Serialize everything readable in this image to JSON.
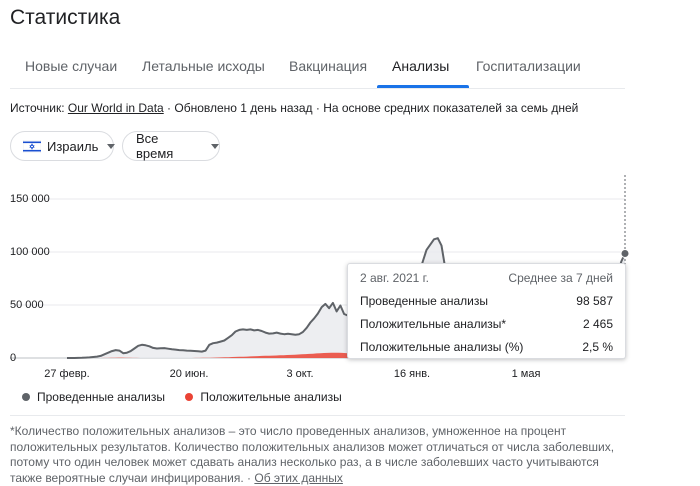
{
  "title": "Статистика",
  "tabs": [
    {
      "label": "Новые случаи",
      "active": false
    },
    {
      "label": "Летальные исходы",
      "active": false
    },
    {
      "label": "Вакцинация",
      "active": false
    },
    {
      "label": "Анализы",
      "active": true
    },
    {
      "label": "Госпитализации",
      "active": false
    }
  ],
  "source": {
    "prefix": "Источник: ",
    "link": "Our World in Data",
    "updated": " · Обновлено 1 день назад",
    "basis": " · На основе средних показателей за семь дней"
  },
  "filters": {
    "country": "Израиль",
    "period": "Все время"
  },
  "colors": {
    "tests": "#5f6368",
    "positive": "#ea4335",
    "accent": "#1a73e8"
  },
  "chart_data": {
    "type": "area",
    "x_tick_labels": [
      "27 февр.",
      "20 июн.",
      "3 окт.",
      "16 янв.",
      "1 мая"
    ],
    "y_tick_labels": [
      "150 000",
      "100 000",
      "50 000",
      "0"
    ],
    "ylim": [
      0,
      150000
    ],
    "grid": true,
    "series": [
      {
        "name": "Проведенные анализы",
        "color": "#5f6368",
        "values": [
          0,
          0,
          0,
          100,
          200,
          400,
          600,
          900,
          1300,
          2000,
          3500,
          5000,
          6500,
          7500,
          7000,
          4500,
          5000,
          6500,
          9000,
          11500,
          12500,
          12000,
          11000,
          9500,
          9000,
          9200,
          9300,
          8800,
          8200,
          7900,
          7500,
          7300,
          7000,
          6800,
          6600,
          6300,
          6000,
          7000,
          12500,
          14000,
          14500,
          15500,
          16500,
          19000,
          21500,
          25000,
          26500,
          27000,
          26500,
          27000,
          26000,
          26500,
          25500,
          24000,
          23000,
          23200,
          24000,
          23000,
          22500,
          22800,
          22500,
          22000,
          22500,
          24500,
          28500,
          33500,
          37500,
          42000,
          48000,
          51000,
          47000,
          52000,
          44000,
          49500,
          41500,
          40000,
          37500,
          35000,
          33500,
          32500,
          32000,
          32000,
          33500,
          32000,
          32000,
          35000,
          33500,
          35000,
          34500,
          38000,
          47500,
          51000,
          60000,
          68000,
          80000,
          91000,
          102000,
          107000,
          112000,
          113000,
          106000,
          85000,
          68000,
          57000,
          50000,
          44000,
          39000,
          35000,
          31000,
          27000,
          23000,
          19500,
          16000,
          13000,
          10500,
          8500,
          7000,
          5800,
          4800,
          4000,
          3500,
          3000,
          2600,
          2300,
          2000,
          1800,
          1700,
          1600,
          1500,
          1500,
          1500,
          1500,
          1500,
          1600,
          1700,
          1800,
          2000,
          2200,
          2500,
          3000,
          4500,
          7000,
          12000,
          20000,
          32000,
          46000,
          62000,
          78000,
          91000,
          98587
        ],
        "sampled_from": "2020-02-01 to 2021-08-02 (approx. every 4 days)"
      },
      {
        "name": "Положительные анализы",
        "color": "#ea4335",
        "values": [
          0,
          0,
          0,
          0,
          0,
          0,
          0,
          0,
          0,
          20,
          60,
          120,
          200,
          300,
          400,
          350,
          250,
          150,
          80,
          50,
          40,
          30,
          25,
          20,
          20,
          20,
          20,
          20,
          20,
          20,
          20,
          20,
          20,
          30,
          40,
          60,
          100,
          150,
          220,
          300,
          400,
          500,
          600,
          700,
          800,
          900,
          1000,
          1100,
          1200,
          1350,
          1500,
          1650,
          1800,
          1950,
          2100,
          2200,
          2300,
          2400,
          2500,
          2650,
          2800,
          2950,
          3100,
          3300,
          3500,
          3700,
          3900,
          4100,
          4300,
          4500,
          4700,
          4800,
          4900,
          5000,
          4900,
          4800,
          4600,
          4300,
          4000,
          3700,
          3300,
          3000,
          2700,
          2400,
          2100,
          1800,
          1600,
          1400,
          1200,
          1100,
          1000,
          1000,
          1100,
          1300,
          1600,
          2000,
          2500,
          3000,
          3500,
          4000,
          4500,
          5000,
          5500,
          5800,
          5500,
          5000,
          4500,
          4000,
          3500,
          3000,
          2500,
          2000,
          1600,
          1300,
          1000,
          800,
          600,
          450,
          300,
          200,
          150,
          100,
          70,
          50,
          40,
          30,
          25,
          20,
          20,
          20,
          20,
          20,
          20,
          20,
          20,
          20,
          25,
          30,
          40,
          50,
          70,
          100,
          150,
          250,
          400,
          600,
          900,
          1300,
          1700,
          2100,
          2300,
          2400,
          2465
        ]
      }
    ],
    "legend": [
      "Проведенные анализы",
      "Положительные анализы"
    ],
    "legend_position": "bottom"
  },
  "tooltip": {
    "date": "2 авг. 2021 г.",
    "caption": "Среднее за 7 дней",
    "rows": [
      {
        "label": "Проведенные анализы",
        "value": "98 587"
      },
      {
        "label": "Положительные анализы*",
        "value": "2 465"
      },
      {
        "label": "Положительные анализы (%)",
        "value": "2,5 %"
      }
    ]
  },
  "footnote": {
    "text": "*Количество положительных анализов – это число проведенных анализов, умноженное на процент положительных результатов. Количество положительных анализов может отличаться от числа заболевших, потому что один человек может сдавать анализ несколько раз, а в числе заболевших часто учитываются также вероятные случаи инфицирования.",
    "separator": " · ",
    "link": "Об этих данных"
  }
}
